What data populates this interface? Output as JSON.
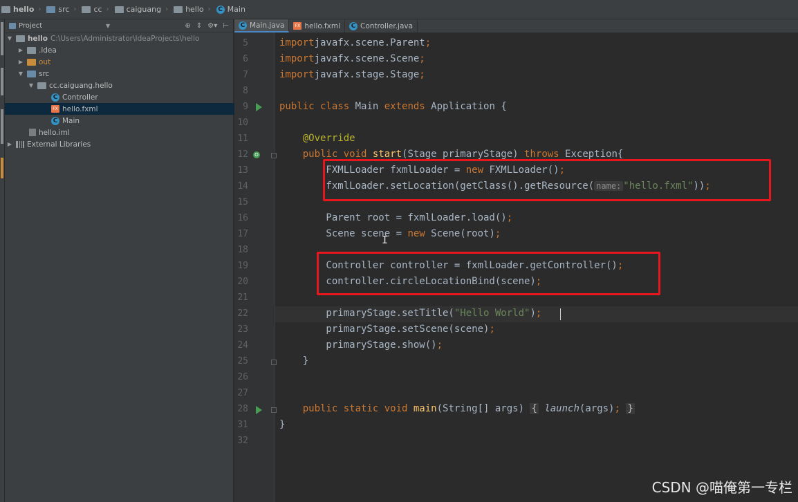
{
  "breadcrumb": [
    "hello",
    "src",
    "cc",
    "caiguang",
    "hello",
    "Main"
  ],
  "project_panel": {
    "title": "Project",
    "tree": [
      {
        "label": "hello",
        "path": "C:\\Users\\Administrator\\IdeaProjects\\hello"
      },
      {
        "label": ".idea"
      },
      {
        "label": "out"
      },
      {
        "label": "src"
      },
      {
        "label": "cc.caiguang.hello"
      },
      {
        "label": "Controller"
      },
      {
        "label": "hello.fxml"
      },
      {
        "label": "Main"
      },
      {
        "label": "hello.iml"
      },
      {
        "label": "External Libraries"
      }
    ]
  },
  "tabs": [
    "Main.java",
    "hello.fxml",
    "Controller.java"
  ],
  "code": {
    "line_numbers": [
      "5",
      "6",
      "7",
      "8",
      "9",
      "10",
      "11",
      "12",
      "13",
      "14",
      "15",
      "16",
      "17",
      "18",
      "19",
      "20",
      "21",
      "22",
      "23",
      "24",
      "25",
      "26",
      "27",
      "28",
      "31",
      "32"
    ],
    "lines": [
      [
        [
          "kw",
          "import"
        ],
        [
          "",
          "javafx.scene.Parent"
        ],
        [
          "kw",
          ";"
        ]
      ],
      [
        [
          "kw",
          "import"
        ],
        [
          "",
          "javafx.scene.Scene"
        ],
        [
          "kw",
          ";"
        ]
      ],
      [
        [
          "kw",
          "import"
        ],
        [
          "",
          "javafx.stage.Stage"
        ],
        [
          "kw",
          ";"
        ]
      ],
      [],
      [
        [
          "kw",
          "public class"
        ],
        [
          "",
          " Main "
        ],
        [
          "kw",
          "extends"
        ],
        [
          "",
          " Application {"
        ]
      ],
      [],
      [
        [
          "",
          "    "
        ],
        [
          "ann",
          "@Override"
        ]
      ],
      [
        [
          "",
          "    "
        ],
        [
          "kw",
          "public void"
        ],
        [
          "mth",
          " start"
        ],
        [
          "",
          "(Stage primaryStage) "
        ],
        [
          "kw",
          "throws"
        ],
        [
          "",
          " Exception{"
        ]
      ],
      [
        [
          "",
          "        FXMLLoader fxmlLoader = "
        ],
        [
          "kw",
          "new"
        ],
        [
          "",
          " FXMLLoader()"
        ],
        [
          "kw",
          ";"
        ]
      ],
      [
        [
          "",
          "        fxmlLoader.setLocation(getClass().getResource("
        ],
        [
          "hint",
          "name:"
        ],
        [
          "str",
          "\"hello.fxml\""
        ],
        [
          "",
          "))"
        ],
        [
          "kw",
          ";"
        ]
      ],
      [],
      [
        [
          "",
          "        Parent root = fxmlLoader.load()"
        ],
        [
          "kw",
          ";"
        ]
      ],
      [
        [
          "",
          "        Scene scene = "
        ],
        [
          "kw",
          "new"
        ],
        [
          "",
          " Scene(root)"
        ],
        [
          "kw",
          ";"
        ]
      ],
      [],
      [
        [
          "",
          "        Controller controller = fxmlLoader.getController()"
        ],
        [
          "kw",
          ";"
        ]
      ],
      [
        [
          "",
          "        controller.circleLocationBind(scene)"
        ],
        [
          "kw",
          ";"
        ]
      ],
      [],
      [
        [
          "",
          "        primaryStage.setTitle("
        ],
        [
          "str",
          "\"Hello World\""
        ],
        [
          "",
          ")"
        ],
        [
          "kw",
          ";"
        ]
      ],
      [
        [
          "",
          "        primaryStage.setScene(scene)"
        ],
        [
          "kw",
          ";"
        ]
      ],
      [
        [
          "",
          "        primaryStage.show()"
        ],
        [
          "kw",
          ";"
        ]
      ],
      [
        [
          "",
          "    }"
        ]
      ],
      [],
      [],
      [
        [
          "",
          "    "
        ],
        [
          "kw",
          "public static void"
        ],
        [
          "mth",
          " main"
        ],
        [
          "",
          "(String[] args) "
        ],
        [
          "fold",
          "{"
        ],
        [
          "",
          " "
        ],
        [
          "ital",
          "launch"
        ],
        [
          "",
          "(args)"
        ],
        [
          "kw",
          ";"
        ],
        [
          "",
          " "
        ],
        [
          "fold",
          "}"
        ]
      ],
      [
        [
          "",
          "}"
        ]
      ],
      []
    ]
  },
  "watermark": "CSDN @喵俺第一专栏"
}
